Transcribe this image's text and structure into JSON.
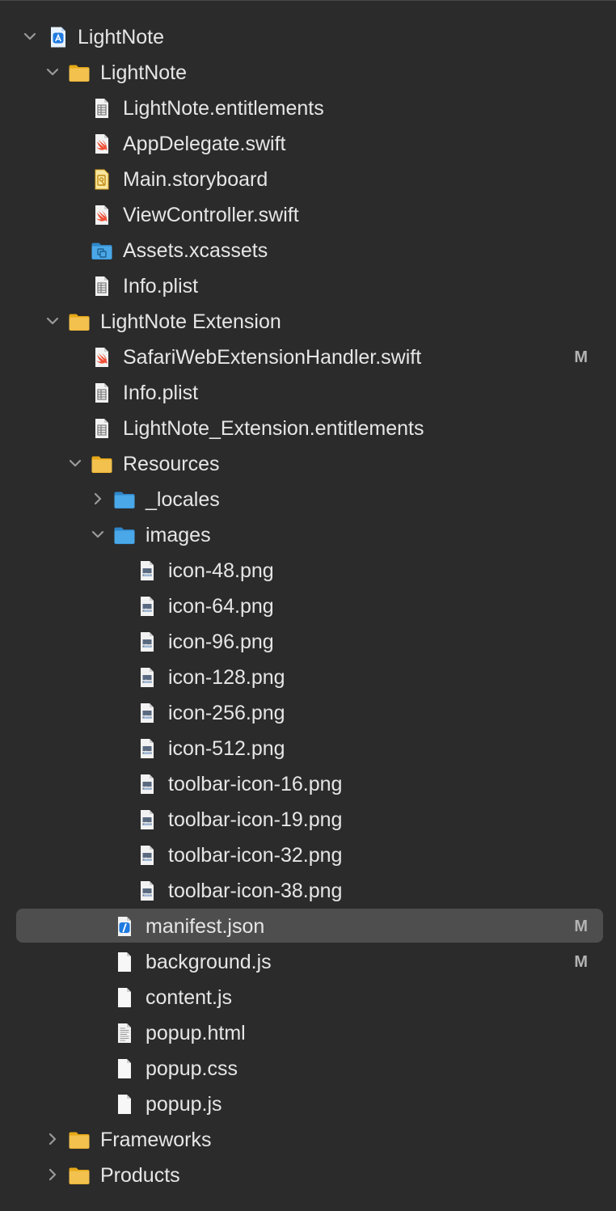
{
  "tree": [
    {
      "depth": 0,
      "label": "LightNote",
      "icon": "xcode-project-icon",
      "chevron": "down"
    },
    {
      "depth": 1,
      "label": "LightNote",
      "icon": "folder-yellow-icon",
      "chevron": "down"
    },
    {
      "depth": 2,
      "label": "LightNote.entitlements",
      "icon": "plist-file-icon"
    },
    {
      "depth": 2,
      "label": "AppDelegate.swift",
      "icon": "swift-file-icon"
    },
    {
      "depth": 2,
      "label": "Main.storyboard",
      "icon": "storyboard-file-icon"
    },
    {
      "depth": 2,
      "label": "ViewController.swift",
      "icon": "swift-file-icon"
    },
    {
      "depth": 2,
      "label": "Assets.xcassets",
      "icon": "asset-catalog-icon"
    },
    {
      "depth": 2,
      "label": "Info.plist",
      "icon": "plist-file-icon"
    },
    {
      "depth": 1,
      "label": "LightNote Extension",
      "icon": "folder-yellow-icon",
      "chevron": "down"
    },
    {
      "depth": 2,
      "label": "SafariWebExtensionHandler.swift",
      "icon": "swift-file-icon",
      "badge": "M"
    },
    {
      "depth": 2,
      "label": "Info.plist",
      "icon": "plist-file-icon"
    },
    {
      "depth": 2,
      "label": "LightNote_Extension.entitlements",
      "icon": "plist-file-icon"
    },
    {
      "depth": 2,
      "label": "Resources",
      "icon": "folder-yellow-icon",
      "chevron": "down"
    },
    {
      "depth": 3,
      "label": "_locales",
      "icon": "folder-blue-icon",
      "chevron": "right"
    },
    {
      "depth": 3,
      "label": "images",
      "icon": "folder-blue-icon",
      "chevron": "down"
    },
    {
      "depth": 4,
      "label": "icon-48.png",
      "icon": "image-file-icon"
    },
    {
      "depth": 4,
      "label": "icon-64.png",
      "icon": "image-file-icon"
    },
    {
      "depth": 4,
      "label": "icon-96.png",
      "icon": "image-file-icon"
    },
    {
      "depth": 4,
      "label": "icon-128.png",
      "icon": "image-file-icon"
    },
    {
      "depth": 4,
      "label": "icon-256.png",
      "icon": "image-file-icon"
    },
    {
      "depth": 4,
      "label": "icon-512.png",
      "icon": "image-file-icon"
    },
    {
      "depth": 4,
      "label": "toolbar-icon-16.png",
      "icon": "image-file-icon"
    },
    {
      "depth": 4,
      "label": "toolbar-icon-19.png",
      "icon": "image-file-icon"
    },
    {
      "depth": 4,
      "label": "toolbar-icon-32.png",
      "icon": "image-file-icon"
    },
    {
      "depth": 4,
      "label": "toolbar-icon-38.png",
      "icon": "image-file-icon"
    },
    {
      "depth": 3,
      "label": "manifest.json",
      "icon": "json-file-icon",
      "badge": "M",
      "selected": true
    },
    {
      "depth": 3,
      "label": "background.js",
      "icon": "blank-file-icon",
      "badge": "M"
    },
    {
      "depth": 3,
      "label": "content.js",
      "icon": "blank-file-icon"
    },
    {
      "depth": 3,
      "label": "popup.html",
      "icon": "html-file-icon"
    },
    {
      "depth": 3,
      "label": "popup.css",
      "icon": "blank-file-icon"
    },
    {
      "depth": 3,
      "label": "popup.js",
      "icon": "blank-file-icon"
    },
    {
      "depth": 1,
      "label": "Frameworks",
      "icon": "folder-yellow-icon",
      "chevron": "right"
    },
    {
      "depth": 1,
      "label": "Products",
      "icon": "folder-yellow-icon",
      "chevron": "right"
    }
  ],
  "colors": {
    "background": "#2b2b2b",
    "text": "#e6e6e6",
    "selection": "#4e4e4f",
    "badge": "#b3b3b3",
    "chevron": "#9a9a9a",
    "folder_yellow": "#f2c14e",
    "folder_blue": "#4aa8e8",
    "swift": "#f05138"
  }
}
